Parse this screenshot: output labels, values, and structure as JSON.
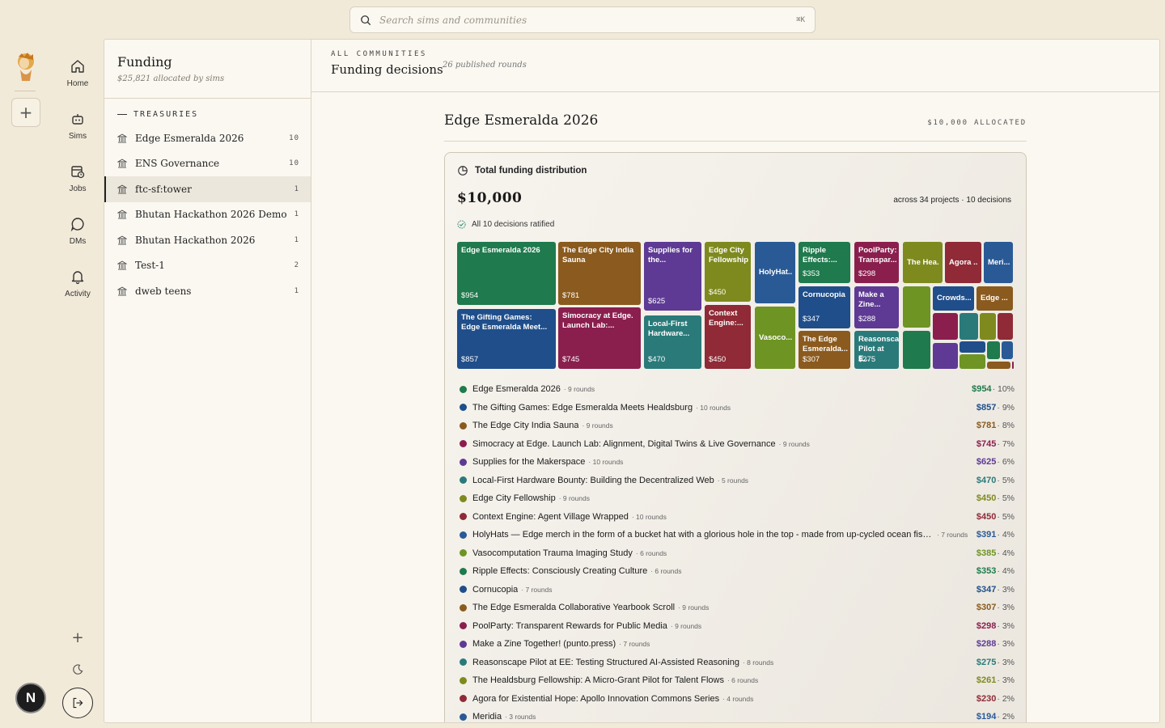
{
  "search": {
    "placeholder": "Search sims and communities",
    "shortcut": "⌘K"
  },
  "rail": {
    "nav": [
      {
        "label": "Home",
        "icon": "home-icon"
      },
      {
        "label": "Sims",
        "icon": "robot-icon"
      },
      {
        "label": "Jobs",
        "icon": "calendar-clock-icon"
      },
      {
        "label": "DMs",
        "icon": "chat-bubble-icon"
      },
      {
        "label": "Activity",
        "icon": "bell-icon"
      }
    ],
    "avatar_initial": "N"
  },
  "sidebar": {
    "title": "Funding",
    "subtitle": "$25,821 allocated by sims",
    "section_label": "TREASURIES",
    "items": [
      {
        "name": "Edge Esmeralda 2026",
        "count": "10"
      },
      {
        "name": "ENS Governance",
        "count": "10"
      },
      {
        "name": "ftc-sf:tower",
        "count": "1"
      },
      {
        "name": "Bhutan Hackathon 2026 Demo",
        "count": "1"
      },
      {
        "name": "Bhutan Hackathon 2026",
        "count": "1"
      },
      {
        "name": "Test-1",
        "count": "2"
      },
      {
        "name": "dweb teens",
        "count": "1"
      }
    ]
  },
  "header": {
    "eyebrow": "ALL COMMUNITIES",
    "title": "Funding decisions",
    "meta": "26 published rounds"
  },
  "community": {
    "title": "Edge Esmeralda 2026",
    "allocated": "$10,000 ALLOCATED",
    "card_title": "Total funding distribution",
    "total": "$10,000",
    "across": "across 34 projects · 10 decisions",
    "ratified": "All 10 decisions ratified"
  },
  "colors": {
    "green": "#1f7a4d",
    "blue": "#1f4e8a",
    "brown": "#8a5a1e",
    "maroon": "#8a1f4e",
    "purple": "#5e3a94",
    "teal": "#2a7a7a",
    "olive": "#7f8a1e",
    "red": "#8f2a36",
    "slate": "#2a5a96",
    "lime": "#6e9424"
  },
  "treemap_tiles": [
    {
      "label": "Edge Esmeralda 2026",
      "value": "$954",
      "color": "#1f7a4d"
    },
    {
      "label": "The Gifting Games: Edge Esmeralda Meet...",
      "value": "$857",
      "color": "#1f4e8a"
    },
    {
      "label": "The Edge City India Sauna",
      "value": "$781",
      "color": "#8a5a1e"
    },
    {
      "label": "Simocracy at Edge. Launch Lab:...",
      "value": "$745",
      "color": "#8a1f4e"
    },
    {
      "label": "Supplies for the...",
      "value": "$625",
      "color": "#5e3a94"
    },
    {
      "label": "Local-First Hardware...",
      "value": "$470",
      "color": "#2a7a7a"
    },
    {
      "label": "Edge City Fellowship",
      "value": "$450",
      "color": "#7f8a1e"
    },
    {
      "label": "Context Engine:...",
      "value": "$450",
      "color": "#8f2a36"
    },
    {
      "label": "HolyHat...",
      "value": "",
      "color": "#2a5a96"
    },
    {
      "label": "Vasoco...",
      "value": "",
      "color": "#6e9424"
    },
    {
      "label": "Ripple Effects:...",
      "value": "$353",
      "color": "#1f7a4d"
    },
    {
      "label": "Cornucopia",
      "value": "$347",
      "color": "#1f4e8a"
    },
    {
      "label": "The Edge Esmeralda...",
      "value": "$307",
      "color": "#8a5a1e"
    },
    {
      "label": "PoolParty: Transpar...",
      "value": "$298",
      "color": "#8a1f4e"
    },
    {
      "label": "Make a Zine...",
      "value": "$288",
      "color": "#5e3a94"
    },
    {
      "label": "Reasonscap Pilot at E...",
      "value": "$275",
      "color": "#2a7a7a"
    },
    {
      "label": "The Hea...",
      "value": "",
      "color": "#7f8a1e"
    },
    {
      "label": "Agora ...",
      "value": "",
      "color": "#8f2a36"
    },
    {
      "label": "Meri...",
      "value": "",
      "color": "#2a5a96"
    },
    {
      "label": "Crowds...",
      "value": "",
      "color": "#1f4e8a"
    },
    {
      "label": "Edge ...",
      "value": "",
      "color": "#8a5a1e"
    }
  ],
  "projects": [
    {
      "name": "Edge Esmeralda 2026",
      "rounds": "· 9 rounds",
      "amount": "$954",
      "pct": "· 10%",
      "color": "#1f7a4d"
    },
    {
      "name": "The Gifting Games: Edge Esmeralda Meets Healdsburg",
      "rounds": "· 10 rounds",
      "amount": "$857",
      "pct": "· 9%",
      "color": "#1f4e8a"
    },
    {
      "name": "The Edge City India Sauna",
      "rounds": "· 9 rounds",
      "amount": "$781",
      "pct": "· 8%",
      "color": "#8a5a1e"
    },
    {
      "name": "Simocracy at Edge. Launch Lab: Alignment, Digital Twins & Live Governance",
      "rounds": "· 9 rounds",
      "amount": "$745",
      "pct": "· 7%",
      "color": "#8a1f4e"
    },
    {
      "name": "Supplies for the Makerspace",
      "rounds": "· 10 rounds",
      "amount": "$625",
      "pct": "· 6%",
      "color": "#5e3a94"
    },
    {
      "name": "Local-First Hardware Bounty: Building the Decentralized Web",
      "rounds": "· 5 rounds",
      "amount": "$470",
      "pct": "· 5%",
      "color": "#2a7a7a"
    },
    {
      "name": "Edge City Fellowship",
      "rounds": "· 9 rounds",
      "amount": "$450",
      "pct": "· 5%",
      "color": "#7f8a1e"
    },
    {
      "name": "Context Engine: Agent Village Wrapped",
      "rounds": "· 10 rounds",
      "amount": "$450",
      "pct": "· 5%",
      "color": "#8f2a36"
    },
    {
      "name": "HolyHats — Edge merch in the form of a bucket hat with a glorious hole in the top - made from up-cycled ocean fishn...",
      "rounds": "· 7 rounds",
      "amount": "$391",
      "pct": "· 4%",
      "color": "#2a5a96"
    },
    {
      "name": "Vasocomputation Trauma Imaging Study",
      "rounds": "· 6 rounds",
      "amount": "$385",
      "pct": "· 4%",
      "color": "#6e9424"
    },
    {
      "name": "Ripple Effects: Consciously Creating Culture",
      "rounds": "· 6 rounds",
      "amount": "$353",
      "pct": "· 4%",
      "color": "#1f7a4d"
    },
    {
      "name": "Cornucopia",
      "rounds": "· 7 rounds",
      "amount": "$347",
      "pct": "· 3%",
      "color": "#1f4e8a"
    },
    {
      "name": "The Edge Esmeralda Collaborative Yearbook Scroll",
      "rounds": "· 9 rounds",
      "amount": "$307",
      "pct": "· 3%",
      "color": "#8a5a1e"
    },
    {
      "name": "PoolParty: Transparent Rewards for Public Media",
      "rounds": "· 9 rounds",
      "amount": "$298",
      "pct": "· 3%",
      "color": "#8a1f4e"
    },
    {
      "name": "Make a Zine Together! (punto.press)",
      "rounds": "· 7 rounds",
      "amount": "$288",
      "pct": "· 3%",
      "color": "#5e3a94"
    },
    {
      "name": "Reasonscape Pilot at EE: Testing Structured AI-Assisted Reasoning",
      "rounds": "· 8 rounds",
      "amount": "$275",
      "pct": "· 3%",
      "color": "#2a7a7a"
    },
    {
      "name": "The Healdsburg Fellowship: A Micro-Grant Pilot for Talent Flows",
      "rounds": "· 6 rounds",
      "amount": "$261",
      "pct": "· 3%",
      "color": "#7f8a1e"
    },
    {
      "name": "Agora for Existential Hope: Apollo Innovation Commons Series",
      "rounds": "· 4 rounds",
      "amount": "$230",
      "pct": "· 2%",
      "color": "#8f2a36"
    },
    {
      "name": "Meridia",
      "rounds": "· 3 rounds",
      "amount": "$194",
      "pct": "· 2%",
      "color": "#2a5a96"
    }
  ]
}
